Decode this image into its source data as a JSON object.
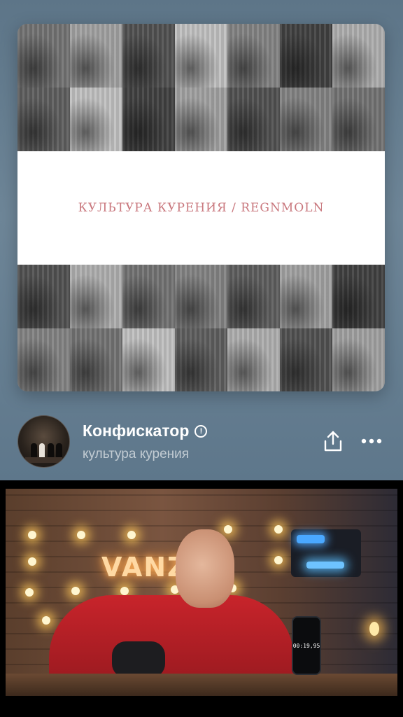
{
  "cover": {
    "banner_text": "КУЛЬТУРА КУРЕНИЯ / REGNMOLN",
    "banner_text_color": "#c9787e"
  },
  "track": {
    "title": "Конфискатор",
    "explicit_badge": "!",
    "artist": "культура курения",
    "share_icon": "share-icon",
    "more_icon": "more-icon"
  },
  "video": {
    "neon_sign": "VANZ",
    "phone_timer": "00:19,95"
  },
  "colors": {
    "player_bg": "#6e8698",
    "title": "#ffffff",
    "subtitle": "rgba(255,255,255,0.62)"
  }
}
